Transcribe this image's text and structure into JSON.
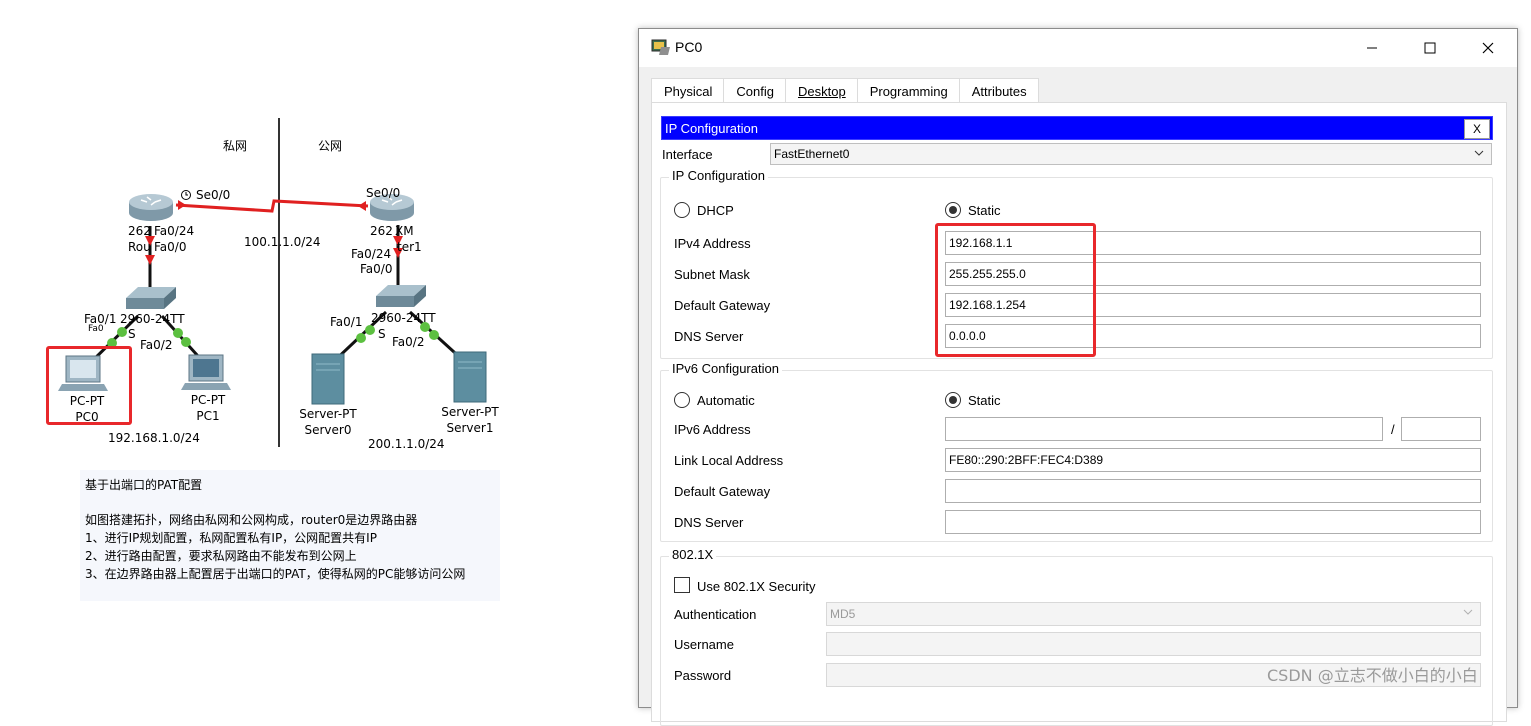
{
  "topology": {
    "zone_private": "私网",
    "zone_public": "公网",
    "router0": {
      "model": "2620XM",
      "port_se": "Se0/0",
      "port_fa": "Fa0/0",
      "model_overlap": "262",
      "fa0_24": "Fa0/24",
      "name_overlap": "Rou"
    },
    "router1": {
      "model": "2620XM",
      "port_se": "Se0/0",
      "model_overlap": "262",
      "xm": "XM",
      "name": "ter1",
      "fa0_24": "Fa0/24",
      "port_fa": "Fa0/0"
    },
    "wan_network": "100.1.1.0/24",
    "switch0": {
      "model": "2960-24TT",
      "port_left": "Fa0/1",
      "port_right": "Fa0/2",
      "fa0_label": "Fa0",
      "s_label": "S"
    },
    "switch1": {
      "model": "2960-24TT",
      "port_left": "Fa0/1",
      "port_right": "Fa0/2",
      "s_label": "S"
    },
    "pc0": {
      "type": "PC-PT",
      "name": "PC0"
    },
    "pc1": {
      "type": "PC-PT",
      "name": "PC1"
    },
    "server0": {
      "type": "Server-PT",
      "name": "Server0"
    },
    "server1": {
      "type": "Server-PT",
      "name": "Server1"
    },
    "private_network": "192.168.1.0/24",
    "public_network": "200.1.1.0/24",
    "note": {
      "title": "基于出端口的PAT配置",
      "line1": "如图搭建拓扑，网络由私网和公网构成，router0是边界路由器",
      "line2": "1、进行IP规划配置，私网配置私有IP，公网配置共有IP",
      "line3": "2、进行路由配置，要求私网路由不能发布到公网上",
      "line4": "3、在边界路由器上配置居于出端口的PAT，使得私网的PC能够访问公网"
    }
  },
  "window": {
    "title": "PC0",
    "tabs": [
      "Physical",
      "Config",
      "Desktop",
      "Programming",
      "Attributes"
    ],
    "active_tab": "Desktop",
    "ip_config": {
      "header": "IP Configuration",
      "close": "X",
      "interface_label": "Interface",
      "interface_value": "FastEthernet0",
      "ipv4_group": "IP Configuration",
      "dhcp": "DHCP",
      "static": "Static",
      "mode": "Static",
      "ipv4_address_label": "IPv4 Address",
      "ipv4_address": "192.168.1.1",
      "subnet_mask_label": "Subnet Mask",
      "subnet_mask": "255.255.255.0",
      "default_gateway_label": "Default Gateway",
      "default_gateway": "192.168.1.254",
      "dns_server_label": "DNS Server",
      "dns_server": "0.0.0.0"
    },
    "ipv6_config": {
      "group": "IPv6 Configuration",
      "automatic": "Automatic",
      "static": "Static",
      "mode": "Static",
      "ipv6_address_label": "IPv6 Address",
      "ipv6_address": "",
      "prefix_sep": "/",
      "prefix": "",
      "link_local_label": "Link Local Address",
      "link_local": "FE80::290:2BFF:FEC4:D389",
      "default_gateway_label": "Default Gateway",
      "default_gateway": "",
      "dns_server_label": "DNS Server",
      "dns_server": ""
    },
    "dot1x": {
      "group": "802.1X",
      "use_label": "Use 802.1X Security",
      "checked": false,
      "authentication_label": "Authentication",
      "authentication": "MD5",
      "username_label": "Username",
      "username": "",
      "password_label": "Password",
      "password": ""
    }
  },
  "watermark": "CSDN @立志不做小白的小白",
  "colors": {
    "highlight": "#e8282b",
    "header_blue": "#0000ff",
    "link_red": "#e02020",
    "port_green": "#5cc040"
  }
}
